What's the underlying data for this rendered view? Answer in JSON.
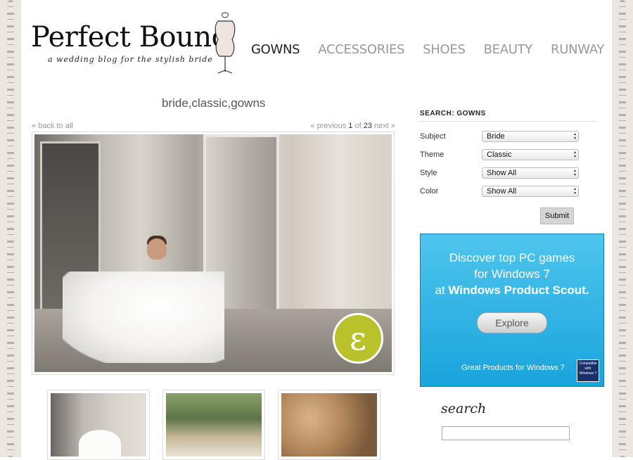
{
  "brand": {
    "title": "Perfect Bound",
    "tagline": "a wedding blog for the stylish bride",
    "accent_color": "#b9c22a"
  },
  "nav": {
    "items": [
      "GOWNS",
      "ACCESSORIES",
      "SHOES",
      "BEAUTY",
      "RUNWAY"
    ],
    "active": "GOWNS"
  },
  "post": {
    "tags": "bride,classic,gowns",
    "back_link": "« back to all",
    "pager": {
      "previous": "« previous",
      "current": "1",
      "of": "of",
      "total": "23",
      "next": "next »"
    },
    "emblem_letter": "ε"
  },
  "search_panel": {
    "heading": "SEARCH: GOWNS",
    "filters": [
      {
        "label": "Subject",
        "value": "Bride"
      },
      {
        "label": "Theme",
        "value": "Classic"
      },
      {
        "label": "Style",
        "value": "Show All"
      },
      {
        "label": "Color",
        "value": "Show All"
      }
    ],
    "submit_label": "Submit"
  },
  "ad": {
    "line1": "Discover top PC games",
    "line2": "for Windows 7",
    "line3_prefix": "at ",
    "line3_bold": "Windows Product Scout.",
    "button": "Explore",
    "footer": "Great Products for Windows 7",
    "badge": "Compatible with Windows 7"
  },
  "site_search": {
    "label": "search",
    "placeholder": ""
  }
}
